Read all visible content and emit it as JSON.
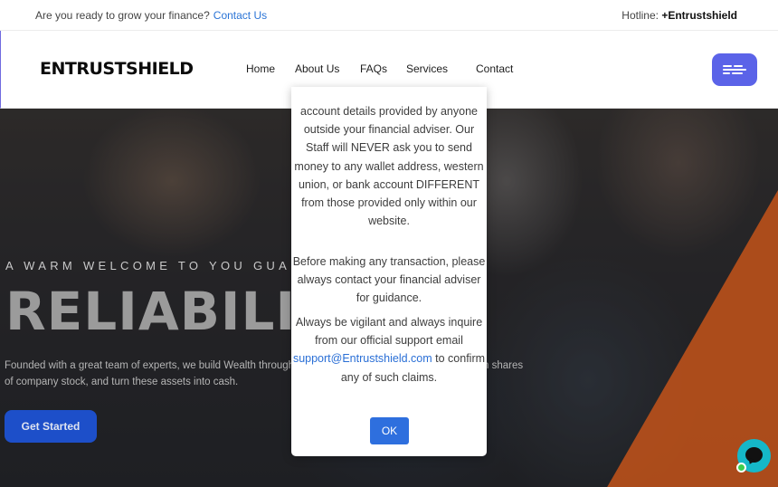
{
  "topbar": {
    "question": "Are you ready to grow your finance?",
    "contact_link": "Contact Us",
    "hotline_label": "Hotline:",
    "hotline_value": "+Entrustshield"
  },
  "nav": {
    "logo": "ENTRUSTSHIELD",
    "items": [
      "Home",
      "About Us",
      "FAQs",
      "Services",
      "Contact"
    ],
    "menu_icon": "hamburger-menu-icon",
    "menu_button_color": "#5b63e8"
  },
  "hero": {
    "eyebrow": "A WARM WELCOME TO YOU GUARAN",
    "headline": "RELIABILI",
    "description_line1": "Founded with a great team of experts, we build Wealth through",
    "description_line1_tail": "n shares",
    "description_line2": "of company stock, and turn these assets into cash.",
    "cta": "Get Started",
    "cta_color": "#1d4fc9",
    "accent_color": "#c4541a"
  },
  "modal": {
    "paragraph1": "account details provided by anyone outside your financial adviser. Our Staff will NEVER ask you to send money to any wallet address, western union, or bank account DIFFERENT from those provided only within our website.",
    "paragraph2": "Before making any transaction, please always contact your financial adviser for guidance.",
    "paragraph3_start": "Always be vigilant and always inquire from our official support email",
    "paragraph3_email": "support@Entrustshield.com",
    "paragraph3_end": "to confirm any of such claims.",
    "ok_button": "OK",
    "ok_color": "#2e6fde"
  },
  "chat_widget": {
    "icon": "chat-bubble-icon",
    "color": "#15b7c8",
    "status_color": "#3ccf4e"
  }
}
